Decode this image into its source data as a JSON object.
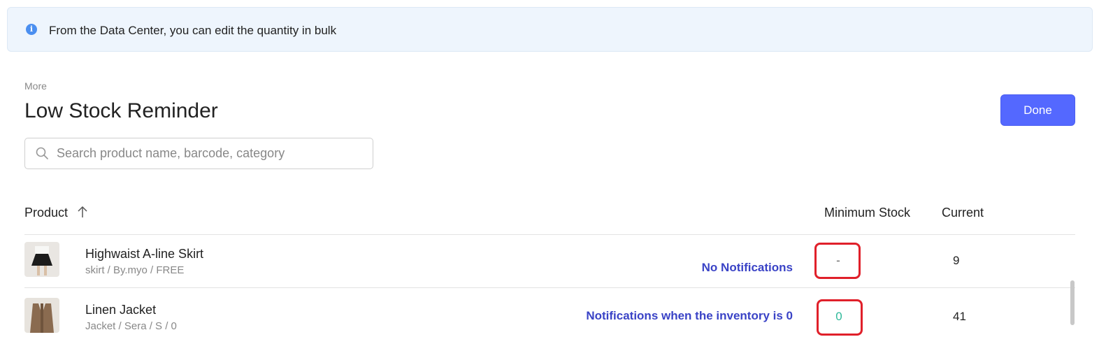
{
  "banner": {
    "icon": "info-icon",
    "text": "From the Data Center, you can edit the quantity in bulk"
  },
  "header": {
    "breadcrumb": "More",
    "title": "Low Stock Reminder",
    "done_label": "Done"
  },
  "search": {
    "placeholder": "Search product name, barcode, category",
    "value": ""
  },
  "table": {
    "columns": {
      "product": "Product",
      "min_stock": "Minimum Stock",
      "current": "Current"
    },
    "sort": "ascending",
    "rows": [
      {
        "name": "Highwaist A-line Skirt",
        "sub": "skirt / By.myo / FREE",
        "notice": "No Notifications",
        "min_stock": "-",
        "current": "9"
      },
      {
        "name": "Linen Jacket",
        "sub": "Jacket / Sera / S / 0",
        "notice": "Notifications when the inventory is 0",
        "min_stock": "0",
        "current": "41"
      }
    ]
  },
  "colors": {
    "accent": "#5468ff",
    "notice": "#3a43c6",
    "highlight": "#e0202a",
    "zero_value": "#2fb99a"
  }
}
